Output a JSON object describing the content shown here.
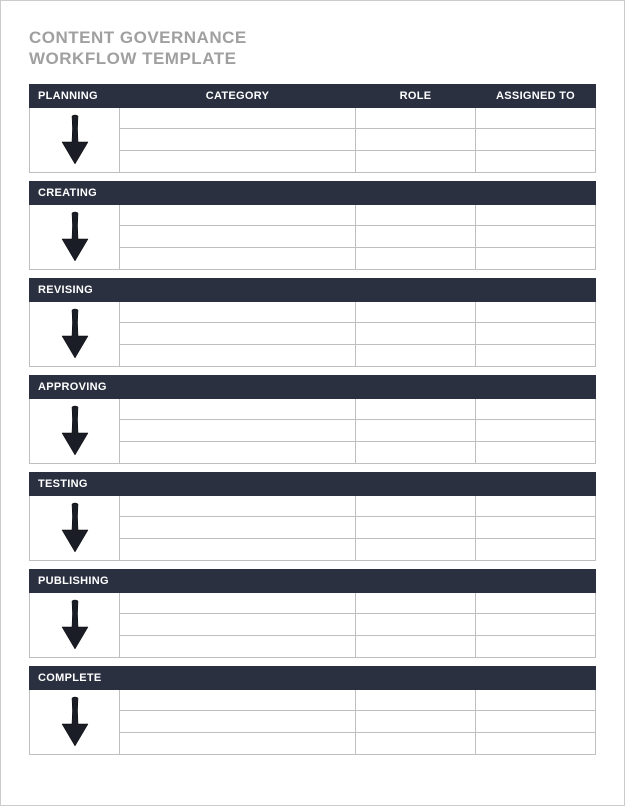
{
  "title_line1": "CONTENT GOVERNANCE",
  "title_line2": "WORKFLOW TEMPLATE",
  "columns": {
    "category": "CATEGORY",
    "role": "ROLE",
    "assigned_to": "ASSIGNED TO"
  },
  "stages": {
    "s0": "PLANNING",
    "s1": "CREATING",
    "s2": "REVISING",
    "s3": "APPROVING",
    "s4": "TESTING",
    "s5": "PUBLISHING",
    "s6": "COMPLETE"
  },
  "rows": {
    "s0": [
      {
        "category": "",
        "role": "",
        "assigned": ""
      },
      {
        "category": "",
        "role": "",
        "assigned": ""
      },
      {
        "category": "",
        "role": "",
        "assigned": ""
      }
    ],
    "s1": [
      {
        "category": "",
        "role": "",
        "assigned": ""
      },
      {
        "category": "",
        "role": "",
        "assigned": ""
      },
      {
        "category": "",
        "role": "",
        "assigned": ""
      }
    ],
    "s2": [
      {
        "category": "",
        "role": "",
        "assigned": ""
      },
      {
        "category": "",
        "role": "",
        "assigned": ""
      },
      {
        "category": "",
        "role": "",
        "assigned": ""
      }
    ],
    "s3": [
      {
        "category": "",
        "role": "",
        "assigned": ""
      },
      {
        "category": "",
        "role": "",
        "assigned": ""
      },
      {
        "category": "",
        "role": "",
        "assigned": ""
      }
    ],
    "s4": [
      {
        "category": "",
        "role": "",
        "assigned": ""
      },
      {
        "category": "",
        "role": "",
        "assigned": ""
      },
      {
        "category": "",
        "role": "",
        "assigned": ""
      }
    ],
    "s5": [
      {
        "category": "",
        "role": "",
        "assigned": ""
      },
      {
        "category": "",
        "role": "",
        "assigned": ""
      },
      {
        "category": "",
        "role": "",
        "assigned": ""
      }
    ],
    "s6": [
      {
        "category": "",
        "role": "",
        "assigned": ""
      },
      {
        "category": "",
        "role": "",
        "assigned": ""
      },
      {
        "category": "",
        "role": "",
        "assigned": ""
      }
    ]
  }
}
